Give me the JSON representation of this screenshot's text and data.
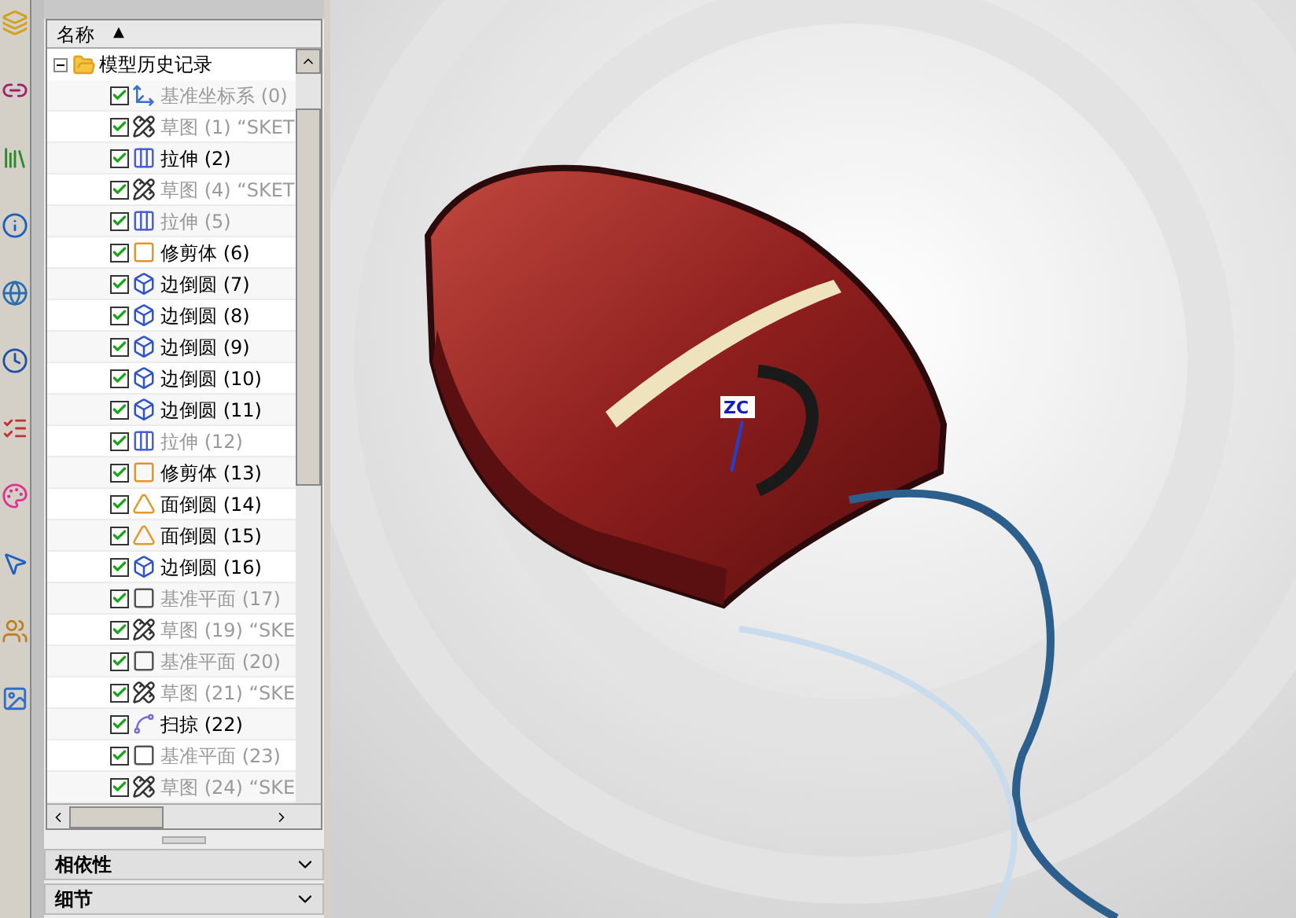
{
  "navigator": {
    "column_header": "名称",
    "sort_mark": "▲",
    "root": {
      "label": "模型历史记录",
      "expanded": true
    },
    "items": [
      {
        "label": "基准坐标系 (0)",
        "kind": "csys",
        "checked": true,
        "dimmed": true
      },
      {
        "label": "草图 (1) “SKET",
        "kind": "sketch",
        "checked": true,
        "dimmed": true
      },
      {
        "label": "拉伸 (2)",
        "kind": "extrude",
        "checked": true,
        "dimmed": false
      },
      {
        "label": "草图 (4) “SKET",
        "kind": "sketch",
        "checked": true,
        "dimmed": true
      },
      {
        "label": "拉伸 (5)",
        "kind": "extrude",
        "checked": true,
        "dimmed": true
      },
      {
        "label": "修剪体 (6)",
        "kind": "trim",
        "checked": true,
        "dimmed": false
      },
      {
        "label": "边倒圆 (7)",
        "kind": "edge_blend",
        "checked": true,
        "dimmed": false
      },
      {
        "label": "边倒圆 (8)",
        "kind": "edge_blend",
        "checked": true,
        "dimmed": false
      },
      {
        "label": "边倒圆 (9)",
        "kind": "edge_blend",
        "checked": true,
        "dimmed": false
      },
      {
        "label": "边倒圆 (10)",
        "kind": "edge_blend",
        "checked": true,
        "dimmed": false
      },
      {
        "label": "边倒圆 (11)",
        "kind": "edge_blend",
        "checked": true,
        "dimmed": false
      },
      {
        "label": "拉伸 (12)",
        "kind": "extrude",
        "checked": true,
        "dimmed": true
      },
      {
        "label": "修剪体 (13)",
        "kind": "trim",
        "checked": true,
        "dimmed": false
      },
      {
        "label": "面倒圆 (14)",
        "kind": "face_blend",
        "checked": true,
        "dimmed": false
      },
      {
        "label": "面倒圆 (15)",
        "kind": "face_blend",
        "checked": true,
        "dimmed": false
      },
      {
        "label": "边倒圆 (16)",
        "kind": "edge_blend",
        "checked": true,
        "dimmed": false
      },
      {
        "label": "基准平面 (17)",
        "kind": "plane",
        "checked": true,
        "dimmed": true
      },
      {
        "label": "草图 (19) “SKE",
        "kind": "sketch",
        "checked": true,
        "dimmed": true
      },
      {
        "label": "基准平面 (20)",
        "kind": "plane",
        "checked": true,
        "dimmed": true
      },
      {
        "label": "草图 (21) “SKE",
        "kind": "sketch",
        "checked": true,
        "dimmed": true
      },
      {
        "label": "扫掠 (22)",
        "kind": "sweep",
        "checked": true,
        "dimmed": false
      },
      {
        "label": "基准平面 (23)",
        "kind": "plane",
        "checked": true,
        "dimmed": true
      },
      {
        "label": "草图 (24) “SKE",
        "kind": "sketch",
        "checked": true,
        "dimmed": true
      }
    ]
  },
  "panels": [
    {
      "label": "相依性",
      "expanded": false
    },
    {
      "label": "细节",
      "expanded": false
    }
  ],
  "viewport": {
    "triad_label": "ZC"
  }
}
